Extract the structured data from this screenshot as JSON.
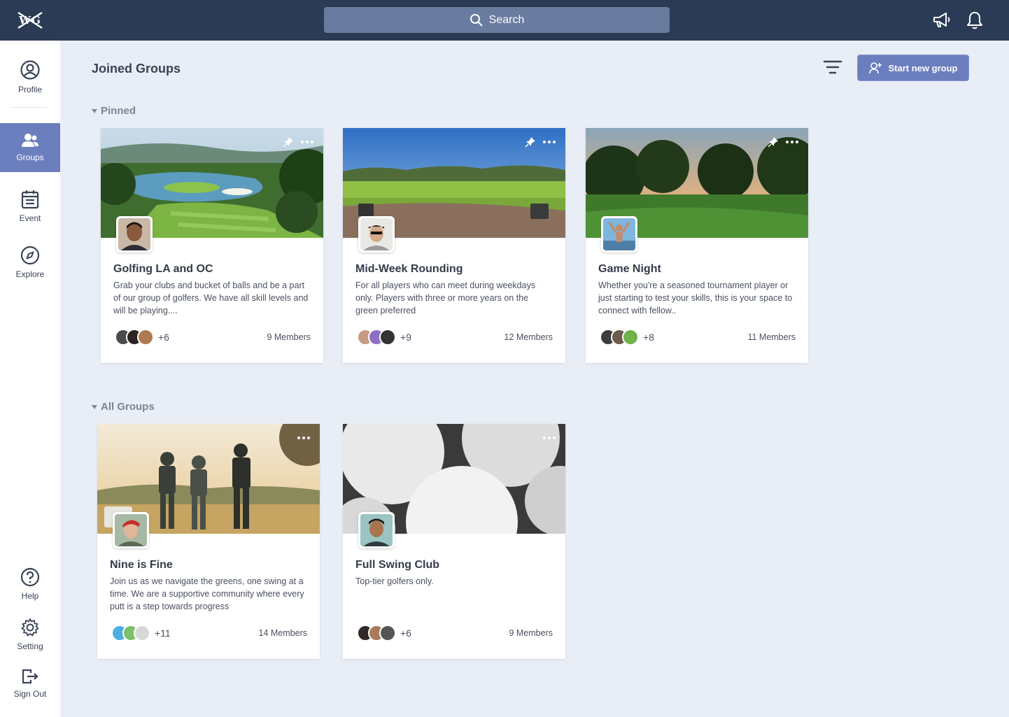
{
  "header": {
    "logo_text": "WG",
    "search_label": "Search"
  },
  "sidebar": {
    "items": [
      {
        "label": "Profile",
        "icon": "user-circle-icon"
      },
      {
        "label": "Groups",
        "icon": "users-icon"
      },
      {
        "label": "Event",
        "icon": "calendar-icon"
      },
      {
        "label": "Explore",
        "icon": "compass-icon"
      },
      {
        "label": "Help",
        "icon": "help-icon"
      },
      {
        "label": "Setting",
        "icon": "gear-icon"
      },
      {
        "label": "Sign Out",
        "icon": "sign-out-icon"
      }
    ],
    "active": "Groups"
  },
  "main": {
    "title": "Joined Groups",
    "new_group_label": "Start new group",
    "sections": {
      "pinned": "Pinned",
      "all": "All Groups"
    }
  },
  "groups": [
    {
      "title": "Golfing LA and OC",
      "desc": "Grab your clubs and bucket of balls and be a part of our group of golfers. We have all skill levels and will be playing....",
      "more": "+6",
      "members": "9 Members",
      "pinned": true
    },
    {
      "title": "Mid-Week Rounding",
      "desc": "For all players who can meet during weekdays only. Players with three or more years on the green preferred",
      "more": "+9",
      "members": "12 Members",
      "pinned": true
    },
    {
      "title": "Game Night",
      "desc": "Whether you're a seasoned tournament player or just starting to test your skills, this is your space to connect with fellow..",
      "more": "+8",
      "members": "11 Members",
      "pinned": true
    },
    {
      "title": "Nine is Fine",
      "desc": "Join us as we navigate the greens, one swing at a time. We are a supportive community where every putt is a step towards progress",
      "more": "+11",
      "members": "14 Members",
      "pinned": false
    },
    {
      "title": "Full Swing Club",
      "desc": "Top-tier golfers only.",
      "more": "+6",
      "members": "9 Members",
      "pinned": false
    }
  ],
  "colors": {
    "topbar": "#2b3a55",
    "accent": "#6b7fbe",
    "background": "#e9eef6"
  }
}
